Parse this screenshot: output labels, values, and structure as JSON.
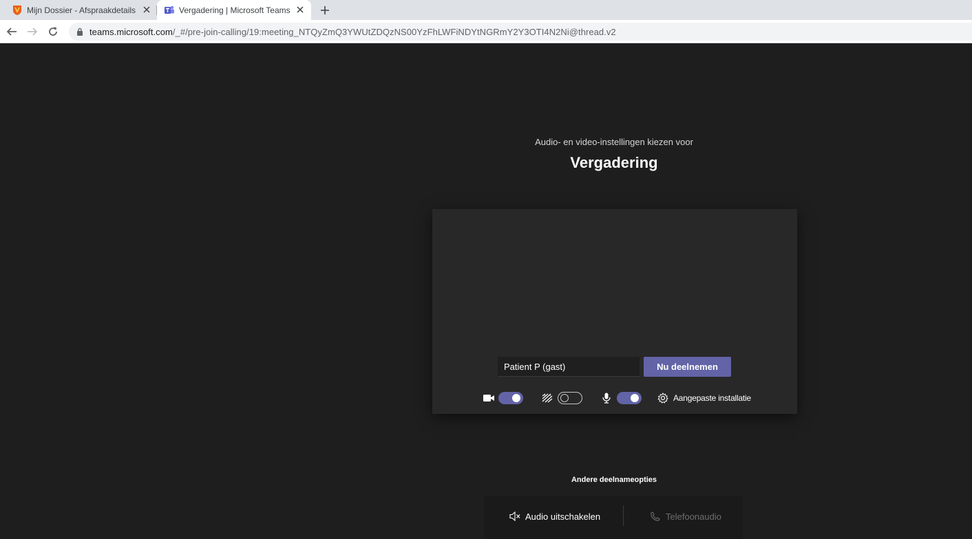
{
  "browser": {
    "tabs": [
      {
        "title": "Mijn Dossier - Afspraakdetails",
        "active": false,
        "icon": "shield-crest-icon"
      },
      {
        "title": "Vergadering | Microsoft Teams",
        "active": true,
        "icon": "teams-icon"
      }
    ],
    "url_host": "teams.microsoft.com",
    "url_path": "/_#/pre-join-calling/19:meeting_NTQyZmQ3YWUtZDQzNS00YzFhLWFiNDYtNGRmY2Y3OTI4N2Ni@thread.v2"
  },
  "prejoin": {
    "subtitle": "Audio- en video-instellingen kiezen voor",
    "heading": "Vergadering",
    "name_value": "Patient P (gast)",
    "join_label": "Nu deelnemen",
    "camera_on": true,
    "blur_on": false,
    "mic_on": true,
    "custom_setup_label": "Aangepaste installatie"
  },
  "other_options": {
    "title": "Andere deelnameopties",
    "audio_off_label": "Audio uitschakelen",
    "phone_audio_label": "Telefoonaudio"
  },
  "colors": {
    "accent": "#6264a7",
    "page_bg": "#1f1e1f",
    "preview_bg": "#292829"
  }
}
